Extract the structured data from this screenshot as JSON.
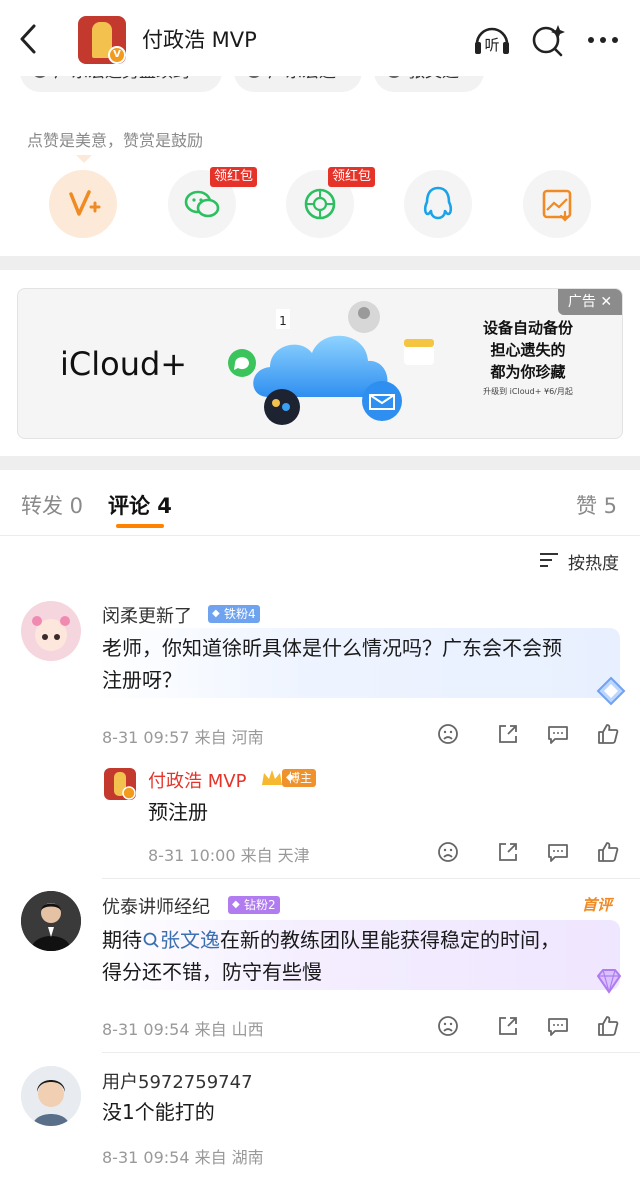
{
  "header": {
    "back_icon": "chevron-left-icon",
    "title": "付政浩 MVP",
    "listen_label": "听",
    "icons": [
      "headphones-icon",
      "ai-search-icon",
      "more-icon"
    ]
  },
  "tags": [
    "广东宏远男篮续约",
    "广东宏远",
    "张文逸"
  ],
  "encourage_text": "点赞是美意，赞赏是鼓励",
  "reward_buttons": [
    {
      "icon": "v-plus-icon",
      "badge": ""
    },
    {
      "icon": "wechat-icon",
      "badge": "领红包"
    },
    {
      "icon": "moments-icon",
      "badge": "领红包"
    },
    {
      "icon": "qq-icon",
      "badge": ""
    },
    {
      "icon": "save-image-icon",
      "badge": ""
    }
  ],
  "ad": {
    "brand": "iCloud+",
    "tag_label": "广告 ✕",
    "lines": [
      "设备自动备份",
      "担心遗失的",
      "都为你珍藏"
    ],
    "small": "升级到 iCloud+ ¥6/月起"
  },
  "tabs": {
    "repost": "转发 0",
    "comments": "评论 4",
    "likes": "赞 5"
  },
  "sort_label": "按热度",
  "comments": [
    {
      "name": "闵柔更新了",
      "badge": "铁粉4",
      "text_l1": "老师，你知道徐昕具体是什么情况吗？广东会不会预",
      "text_l2": "注册呀？",
      "meta": "8-31 09:57  来自 河南",
      "reply": {
        "name": "付政浩 MVP",
        "badge": "博主",
        "text": "预注册",
        "meta": "8-31 10:00  来自 天津"
      }
    },
    {
      "name": "优泰讲师经纪",
      "badge": "钻粉2",
      "tag": "首评",
      "text_pre": "期待",
      "text_link": "张文逸",
      "text_l1_rest": "在新的教练团队里能获得稳定的时间，",
      "text_l2": "得分还不错，防守有些慢",
      "meta": "8-31 09:54  来自 山西"
    },
    {
      "name": "用户5972759747",
      "text": "没1个能打的",
      "meta": "8-31 09:54  来自 湖南"
    }
  ],
  "colors": {
    "accent": "#ff8200",
    "iron_badge": "#6fa3f0",
    "diamond_badge": "#b07cf0",
    "blogger_badge": "#f0922c",
    "link": "#3a6fb0"
  }
}
